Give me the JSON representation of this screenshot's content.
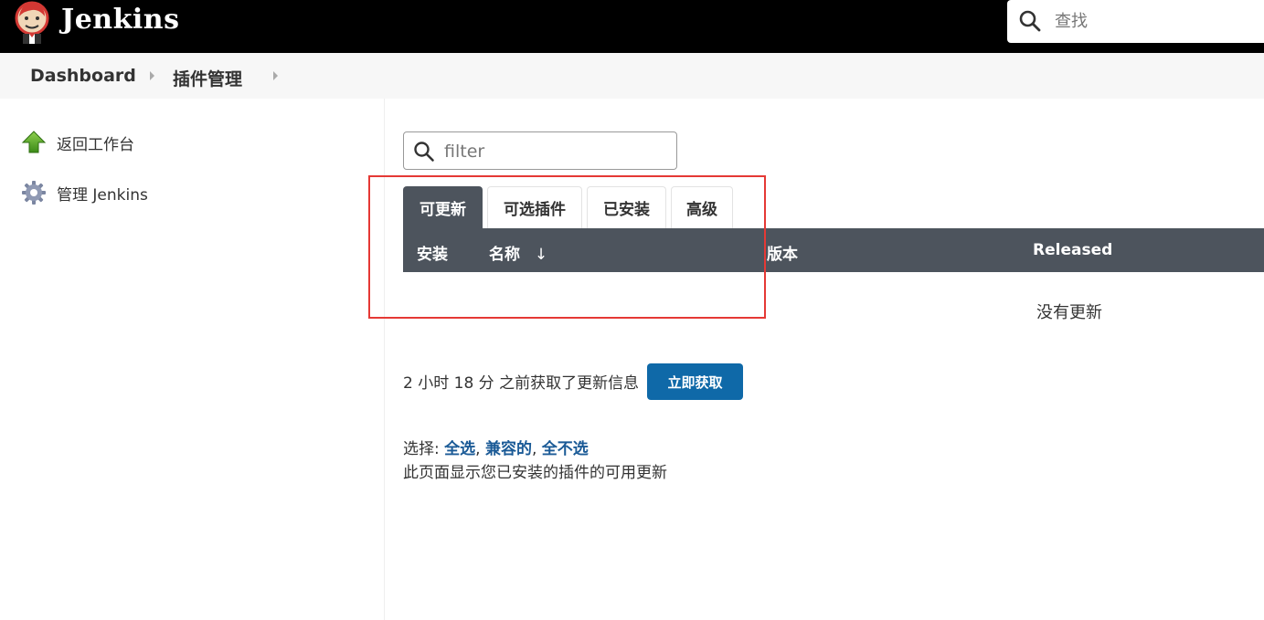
{
  "app": {
    "brand": "Jenkins",
    "search_placeholder": "查找"
  },
  "breadcrumb": {
    "items": [
      "Dashboard",
      "插件管理"
    ]
  },
  "sidebar": {
    "items": [
      {
        "label": "返回工作台",
        "icon": "up-arrow-icon"
      },
      {
        "label": "管理 Jenkins",
        "icon": "gear-icon"
      }
    ]
  },
  "main": {
    "filter_placeholder": "filter",
    "tabs": [
      {
        "label": "可更新",
        "active": true
      },
      {
        "label": "可选插件",
        "active": false
      },
      {
        "label": "已安装",
        "active": false
      },
      {
        "label": "高级",
        "active": false
      }
    ],
    "table": {
      "headers": {
        "install": "安装",
        "name": "名称",
        "sort_arrow": "↓",
        "version": "版本",
        "released": "Released"
      },
      "empty_message": "没有更新"
    },
    "updated_info": "2 小时 18 分 之前获取了更新信息",
    "fetch_button": "立即获取",
    "select": {
      "prefix": "选择:",
      "all": "全选",
      "compatible": "兼容的",
      "none": "全不选"
    },
    "description": "此页面显示您已安装的插件的可用更新"
  },
  "colors": {
    "header_bg": "#000000",
    "tab_active_bg": "#4d545d",
    "button_bg": "#0f69a8",
    "link": "#1a5a96",
    "highlight": "#e53935"
  }
}
